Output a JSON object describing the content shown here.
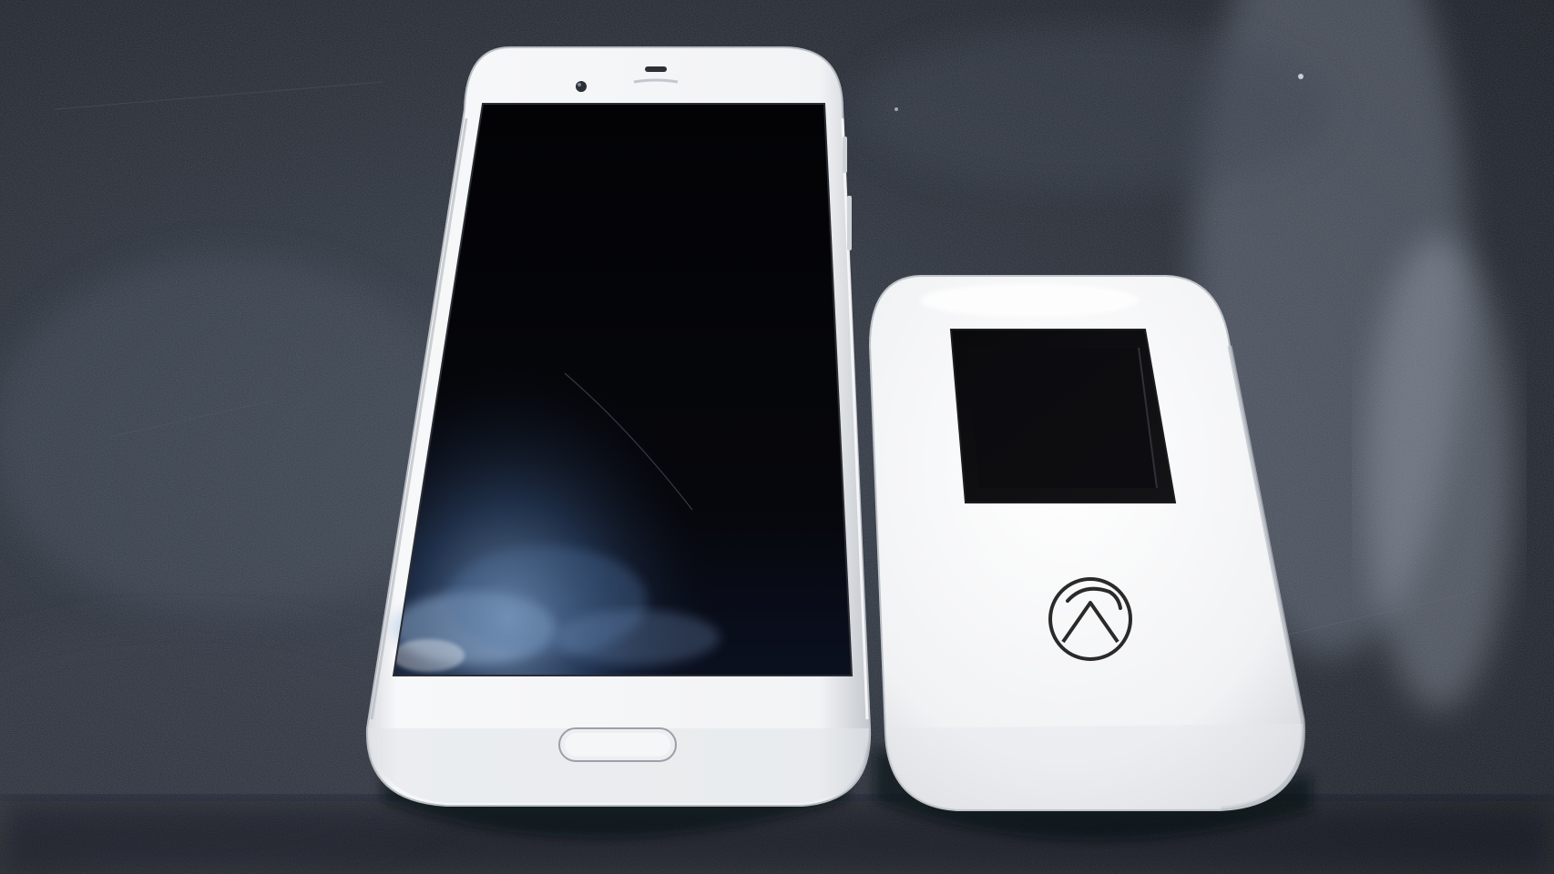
{
  "scene": {
    "description_free": true
  },
  "colors": {
    "table_base": "#1e232c",
    "table_highlight": "#4a5260",
    "device_white": "#f4f5f6",
    "device_shadow": "#c9ccd1",
    "screen_black": "#050507",
    "screen_glare": "#6f8fb8",
    "logo_stroke": "#2a2a2a"
  },
  "objects": [
    {
      "name": "smartphone",
      "icons": [
        "front-camera-icon",
        "earpiece-icon",
        "home-button-icon"
      ]
    },
    {
      "name": "mobile-wifi-router",
      "icons": [
        "router-logo-icon"
      ]
    }
  ]
}
